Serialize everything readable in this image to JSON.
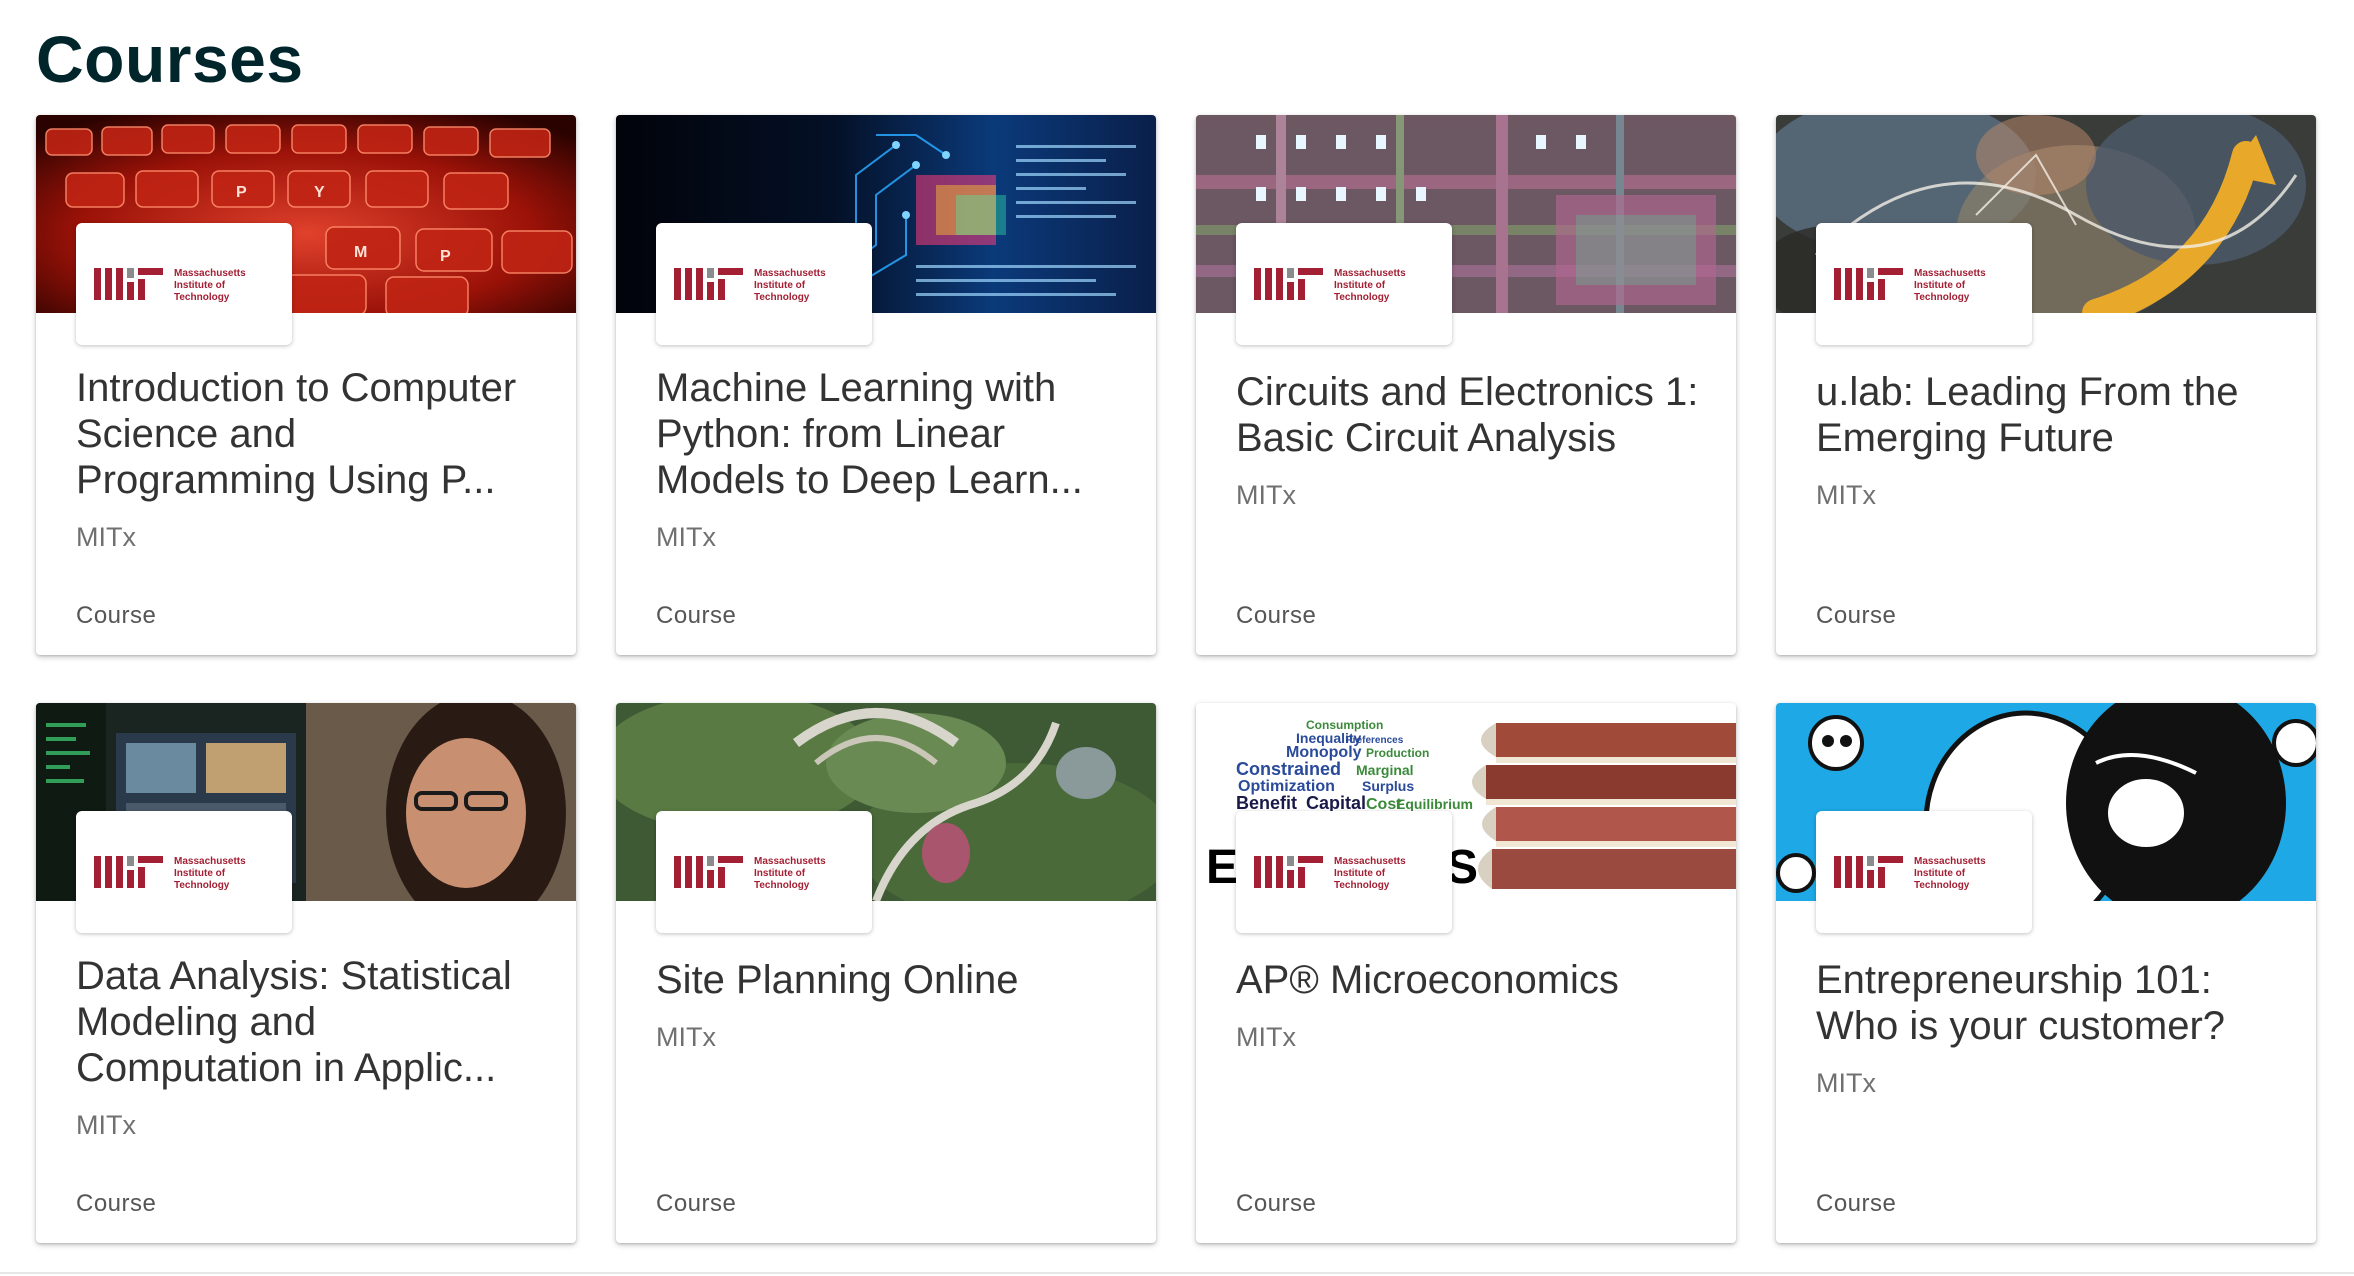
{
  "page": {
    "title": "Courses"
  },
  "logo": {
    "line1": "Massachusetts",
    "line2": "Institute of",
    "line3": "Technology",
    "accent_color": "#a31f34",
    "gray_color": "#8a8b8c"
  },
  "courses": [
    {
      "title": "Introduction to Computer Science and Programming Using P...",
      "org": "MITx",
      "type": "Course",
      "banner_icon": "red-keyboard-image"
    },
    {
      "title": "Machine Learning with Python: from Linear Models to Deep Learn...",
      "org": "MITx",
      "type": "Course",
      "banner_icon": "circuit-code-image"
    },
    {
      "title": "Circuits and Electronics 1: Basic Circuit Analysis",
      "org": "MITx",
      "type": "Course",
      "banner_icon": "chip-die-image"
    },
    {
      "title": "u.lab: Leading From the Emerging Future",
      "org": "MITx",
      "type": "Course",
      "banner_icon": "abstract-art-image"
    },
    {
      "title": "Data Analysis: Statistical Modeling and Computation in Applic...",
      "org": "MITx",
      "type": "Course",
      "banner_icon": "woman-at-screens-image"
    },
    {
      "title": "Site Planning Online",
      "org": "MITx",
      "type": "Course",
      "banner_icon": "aerial-site-image"
    },
    {
      "title": "AP® Microeconomics",
      "org": "MITx",
      "type": "Course",
      "banner_icon": "word-cloud-books-image"
    },
    {
      "title": "Entrepreneurship 101: Who is your customer?",
      "org": "MITx",
      "type": "Course",
      "banner_icon": "cartoon-image"
    }
  ]
}
